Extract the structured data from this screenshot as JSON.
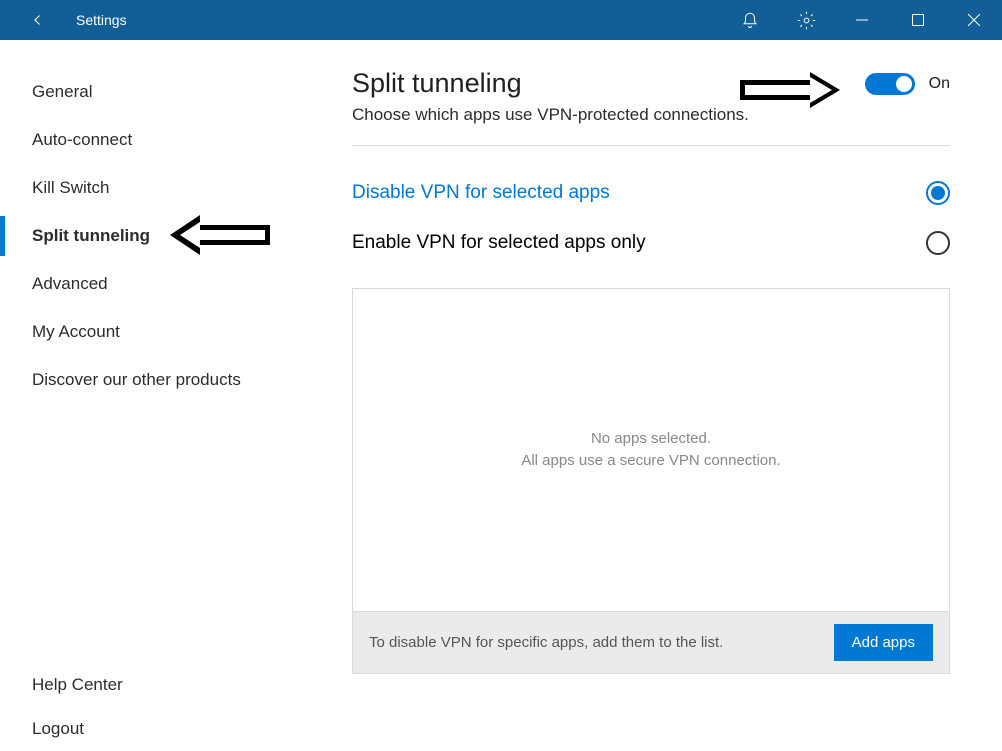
{
  "titlebar": {
    "title": "Settings"
  },
  "sidebar": {
    "items": [
      {
        "label": "General"
      },
      {
        "label": "Auto-connect"
      },
      {
        "label": "Kill Switch"
      },
      {
        "label": "Split tunneling"
      },
      {
        "label": "Advanced"
      },
      {
        "label": "My Account"
      },
      {
        "label": "Discover our other products"
      }
    ],
    "active_index": 3,
    "bottom": [
      {
        "label": "Help Center"
      },
      {
        "label": "Logout"
      }
    ]
  },
  "content": {
    "title": "Split tunneling",
    "subtitle": "Choose which apps use VPN-protected connections.",
    "toggle_label": "On",
    "option1_label": "Disable VPN for selected apps",
    "option2_label": "Enable VPN for selected apps only",
    "empty_line1": "No apps selected.",
    "empty_line2": "All apps use a secure VPN connection.",
    "footer_text": "To disable VPN for specific apps, add them to the list.",
    "add_label": "Add apps"
  }
}
